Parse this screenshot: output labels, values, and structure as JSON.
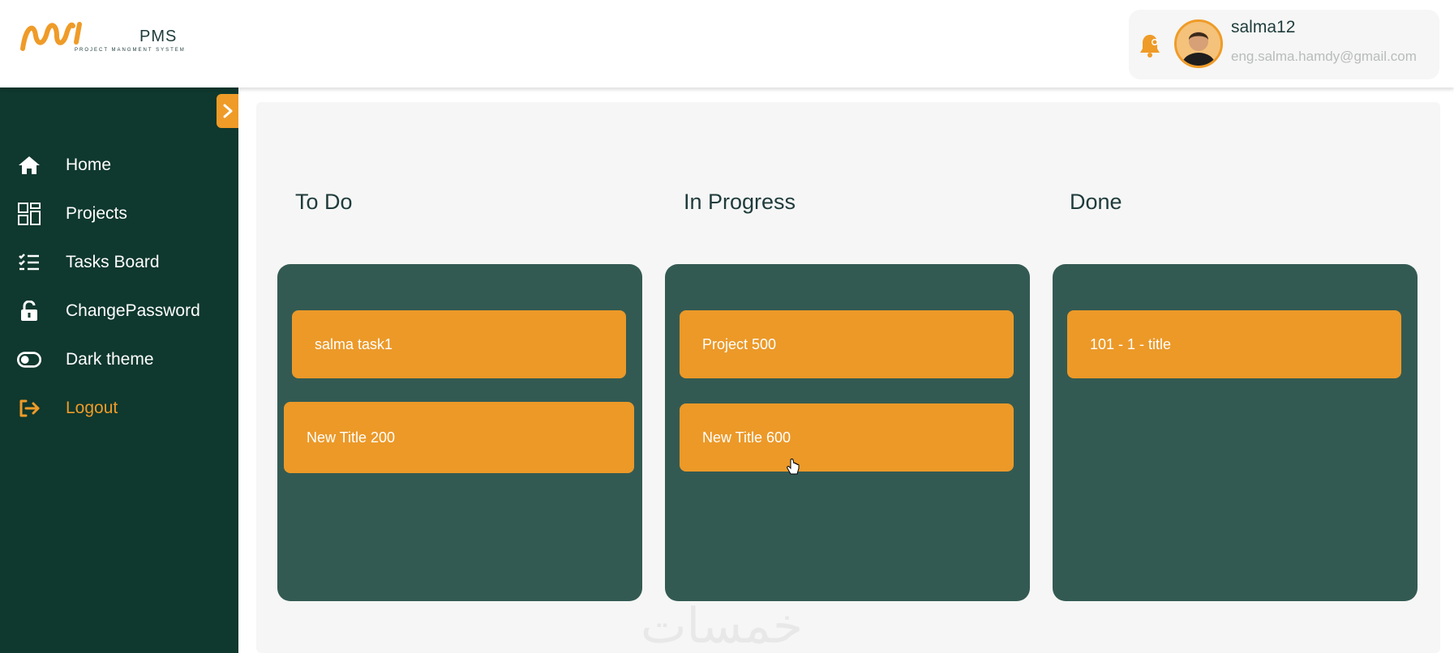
{
  "app": {
    "logo_title": "PMS",
    "logo_subtitle": "PROJECT MANGMENT SYSTEM",
    "accent_color": "#ef9b28",
    "sidebar_color": "#0f382e",
    "column_color": "#335a52"
  },
  "user": {
    "name": "salma12",
    "email": "eng.salma.hamdy@gmail.com"
  },
  "sidebar": {
    "items": [
      {
        "label": "Home",
        "icon": "home-icon"
      },
      {
        "label": "Projects",
        "icon": "projects-grid-icon"
      },
      {
        "label": "Tasks Board",
        "icon": "tasks-list-icon"
      },
      {
        "label": "ChangePassword",
        "icon": "lock-icon"
      },
      {
        "label": "Dark theme",
        "icon": "toggle-icon"
      },
      {
        "label": "Logout",
        "icon": "logout-icon"
      }
    ]
  },
  "board": {
    "columns": [
      {
        "title": "To Do",
        "tasks": [
          "salma task1",
          "New Title 200"
        ]
      },
      {
        "title": "In Progress",
        "tasks": [
          "Project 500",
          "New Title 600"
        ]
      },
      {
        "title": "Done",
        "tasks": [
          "101 - 1 - title"
        ]
      }
    ]
  },
  "watermark": "خمسات"
}
